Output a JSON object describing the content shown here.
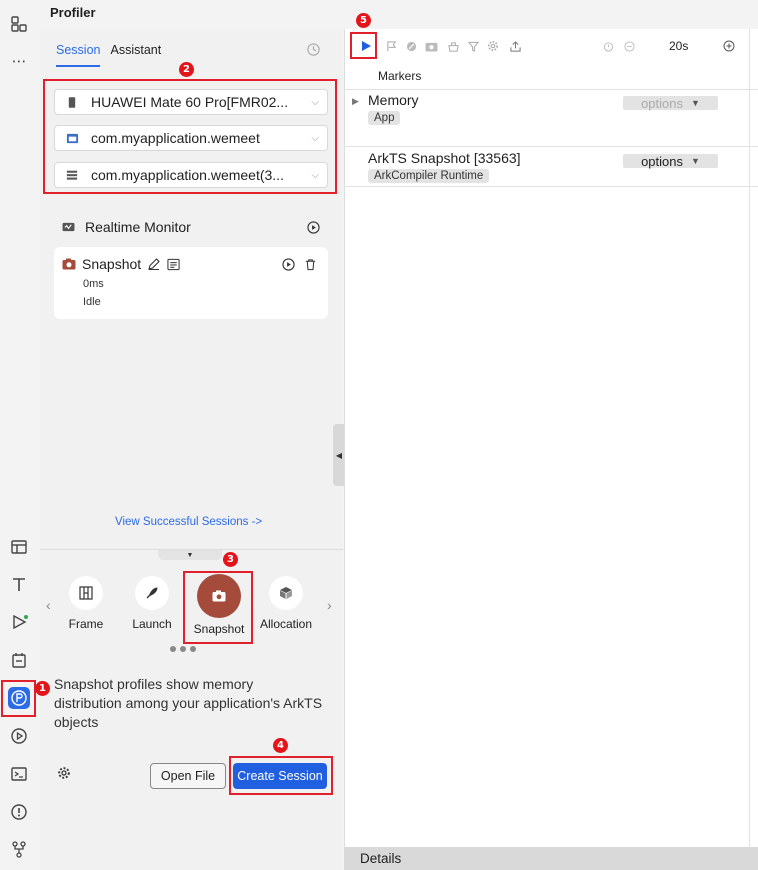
{
  "app": {
    "title": "Profiler"
  },
  "session_panel": {
    "tabs": [
      {
        "label": "Session",
        "active": true
      },
      {
        "label": "Assistant",
        "active": false
      }
    ],
    "selects": {
      "device": "HUAWEI Mate 60 Pro[FMR02...",
      "app": "com.myapplication.wemeet",
      "process": "com.myapplication.wemeet(3..."
    },
    "realtime_monitor": {
      "label": "Realtime Monitor"
    },
    "snapshot_card": {
      "title": "Snapshot",
      "time": "0ms",
      "status": "Idle"
    },
    "view_successful": "View Successful Sessions ->",
    "tools": [
      {
        "label": "Frame",
        "icon": "frame-icon",
        "selected": false
      },
      {
        "label": "Launch",
        "icon": "rocket-icon",
        "selected": false
      },
      {
        "label": "Snapshot",
        "icon": "camera-icon",
        "selected": true
      },
      {
        "label": "Allocation",
        "icon": "cube-icon",
        "selected": false
      }
    ],
    "description": "Snapshot profiles show memory distribution among your application's ArkTS objects",
    "open_file": "Open File",
    "create_session": "Create Session"
  },
  "callouts": [
    "1",
    "2",
    "3",
    "4",
    "5"
  ],
  "profile_area": {
    "time_scale": "20s",
    "markers_label": "Markers",
    "tracks": [
      {
        "name": "Memory",
        "chip": "App",
        "options": "options",
        "enabled": false
      },
      {
        "name": "ArkTS Snapshot [33563]",
        "chip": "ArkCompiler Runtime",
        "options": "options",
        "enabled": true
      }
    ],
    "details_label": "Details"
  },
  "colors": {
    "accent": "#2b6be6",
    "highlight": "#e0202a",
    "snapshot_selected": "#a44b3c"
  }
}
